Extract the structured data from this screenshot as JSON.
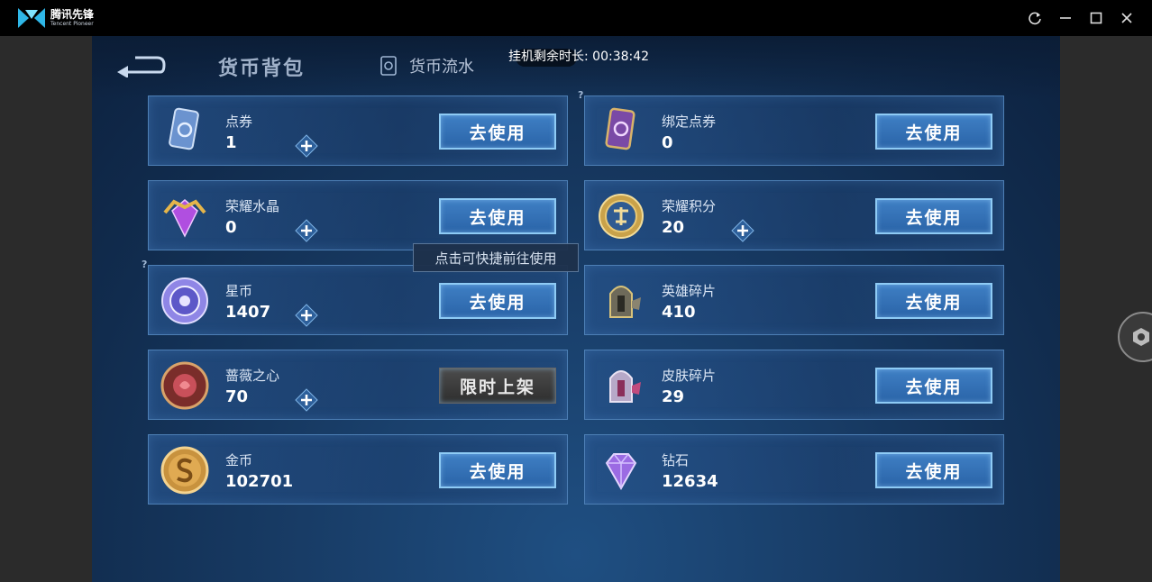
{
  "app": {
    "logo_cn": "腾讯先锋",
    "logo_en": "Tencent Pioneer",
    "brand_color": "#2fb7e8"
  },
  "window_controls": [
    "refresh-icon",
    "minimize-icon",
    "maximize-icon",
    "close-icon"
  ],
  "game": {
    "title": "货币背包",
    "flow_tab": "货币流水",
    "timer": "挂机剩余时长: 00:38:42",
    "tooltip": "点击可快捷前往使用",
    "currencies": [
      {
        "name": "点券",
        "value": "1",
        "button": "去使用",
        "plus": true,
        "icon": "voucher-card-icon"
      },
      {
        "name": "绑定点券",
        "value": "0",
        "button": "去使用",
        "plus": false,
        "icon": "bound-voucher-card-icon"
      },
      {
        "name": "荣耀水晶",
        "value": "0",
        "button": "去使用",
        "plus": true,
        "icon": "glory-crystal-icon"
      },
      {
        "name": "荣耀积分",
        "value": "20",
        "button": "去使用",
        "plus": true,
        "icon": "glory-points-icon"
      },
      {
        "name": "星币",
        "value": "1407",
        "button": "去使用",
        "plus": true,
        "icon": "star-coin-icon"
      },
      {
        "name": "英雄碎片",
        "value": "410",
        "button": "去使用",
        "plus": false,
        "icon": "hero-fragment-icon"
      },
      {
        "name": "蔷薇之心",
        "value": "70",
        "button": "限时上架",
        "plus": true,
        "icon": "rose-heart-icon"
      },
      {
        "name": "皮肤碎片",
        "value": "29",
        "button": "去使用",
        "plus": false,
        "icon": "skin-fragment-icon"
      },
      {
        "name": "金币",
        "value": "102701",
        "button": "去使用",
        "plus": false,
        "icon": "gold-coin-icon"
      },
      {
        "name": "钻石",
        "value": "12634",
        "button": "去使用",
        "plus": false,
        "icon": "diamond-icon"
      }
    ]
  }
}
